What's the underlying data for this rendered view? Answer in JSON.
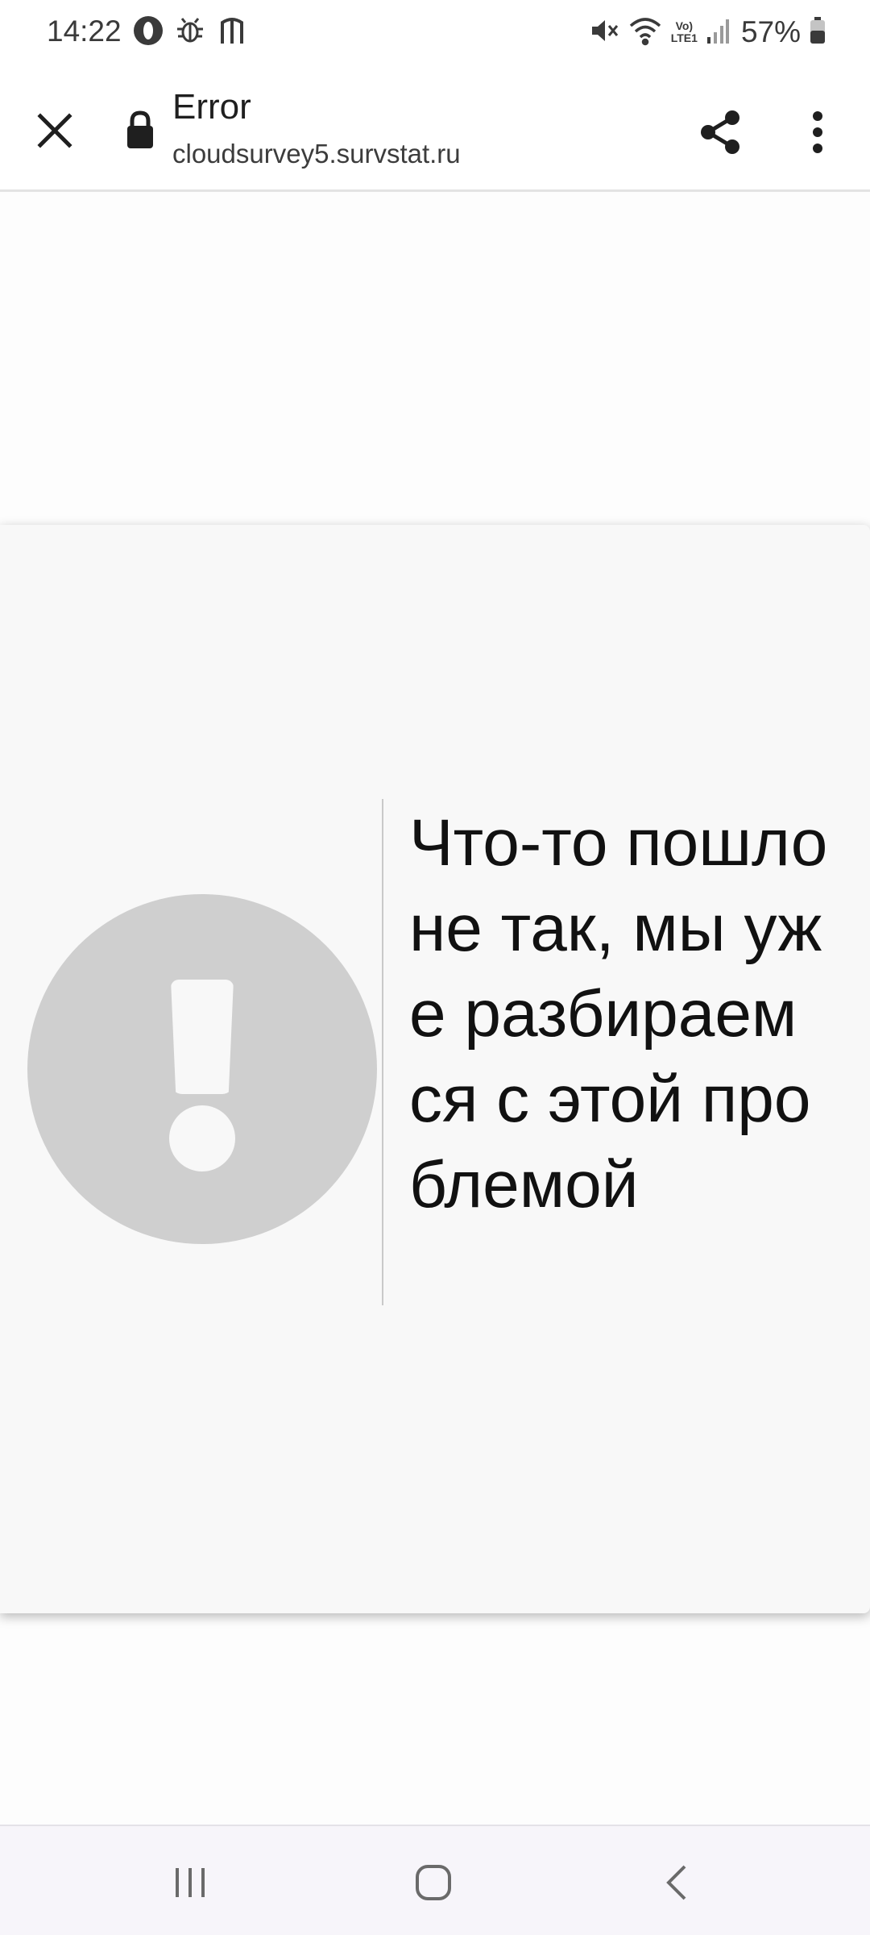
{
  "status_bar": {
    "time": "14:22",
    "battery": "57%",
    "network": [
      "Vo)",
      "LTE1"
    ],
    "icons": [
      "opera-icon",
      "bug-icon",
      "app-icon",
      "mute-icon",
      "wifi-icon",
      "signal-icon",
      "battery-icon"
    ]
  },
  "toolbar": {
    "title": "Error",
    "url": "cloudsurvey5.survstat.ru",
    "icons": [
      "close-icon",
      "lock-icon",
      "share-icon",
      "more-vert-icon"
    ]
  },
  "error": {
    "message": "Что-то пошло не так, мы уже разбираемся с этой проблемой",
    "icon": "exclamation-icon"
  },
  "nav_bar": {
    "icons": [
      "recent-apps-icon",
      "home-icon",
      "back-icon"
    ]
  },
  "colors": {
    "card_bg": "#f8f8f8",
    "icon_circle": "#cfcfcf",
    "nav_bg": "#f7f5fa"
  }
}
